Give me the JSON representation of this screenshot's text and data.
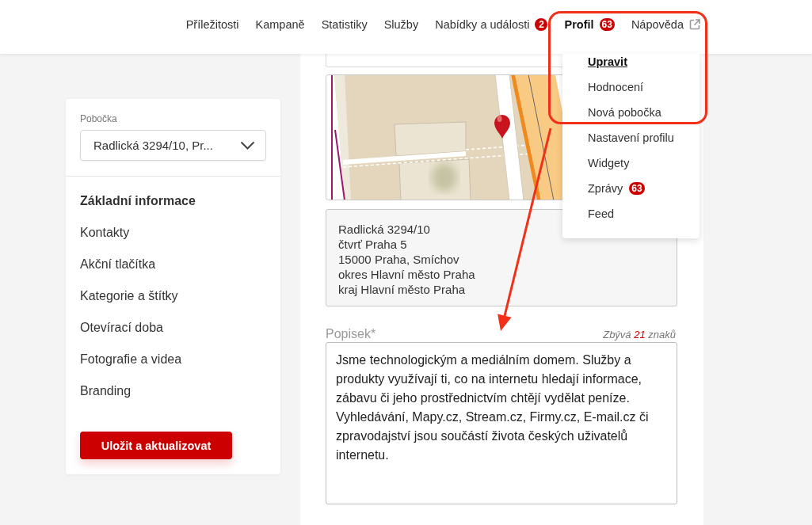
{
  "header": {
    "nav": [
      {
        "label": "Příležitosti",
        "kind": "page",
        "selected": false
      },
      {
        "label": "Kampaně",
        "kind": "page",
        "selected": false
      },
      {
        "label": "Statistiky",
        "kind": "page",
        "selected": false
      },
      {
        "label": "Služby",
        "kind": "page",
        "selected": false
      },
      {
        "label": "Nabídky a události",
        "kind": "page",
        "selected": false,
        "badge": "2"
      },
      {
        "label": "Profil",
        "kind": "page",
        "selected": true,
        "badge": "63"
      },
      {
        "label": "Nápověda",
        "kind": "external",
        "selected": false
      }
    ]
  },
  "profile_menu": {
    "items": [
      {
        "label": "Upravit",
        "selected": true
      },
      {
        "label": "Hodnocení",
        "selected": false
      },
      {
        "label": "Nová pobočka",
        "selected": false
      },
      {
        "label": "Nastavení profilu",
        "selected": false
      },
      {
        "label": "Widgety",
        "selected": false
      },
      {
        "label": "Zprávy",
        "selected": false,
        "badge": "63"
      },
      {
        "label": "Feed",
        "selected": false
      }
    ]
  },
  "sidebar": {
    "branch": {
      "label": "Pobočka",
      "value": "Radlická 3294/10, Pr..."
    },
    "sections": [
      {
        "label": "Základní informace",
        "selected": true
      },
      {
        "label": "Kontakty",
        "selected": false
      },
      {
        "label": "Akční tlačítka",
        "selected": false
      },
      {
        "label": "Kategorie a štítky",
        "selected": false
      },
      {
        "label": "Otevírací doba",
        "selected": false
      },
      {
        "label": "Fotografie a videa",
        "selected": false
      },
      {
        "label": "Branding",
        "selected": false
      }
    ],
    "save_button": "Uložit a aktualizovat"
  },
  "detail": {
    "address_lines": [
      "Radlická 3294/10",
      "čtvrť Praha 5",
      "15000 Praha, Smíchov",
      "okres Hlavní město Praha",
      "kraj Hlavní město Praha"
    ],
    "description": {
      "label": "Popisek*",
      "counter": {
        "prefix": "Zbývá",
        "count": "21",
        "suffix": "znaků"
      },
      "value": "Jsme technologickým a mediálním domem. Služby a produkty využívají ti, co na internetu hledají informace, zábavu či jeho prostřednictvím chtějí vydělat peníze. Vyhledávání, Mapy.cz, Stream.cz, Firmy.cz, E-mail.cz či zpravodajství jsou součástí života českých uživatelů internetu."
    }
  }
}
